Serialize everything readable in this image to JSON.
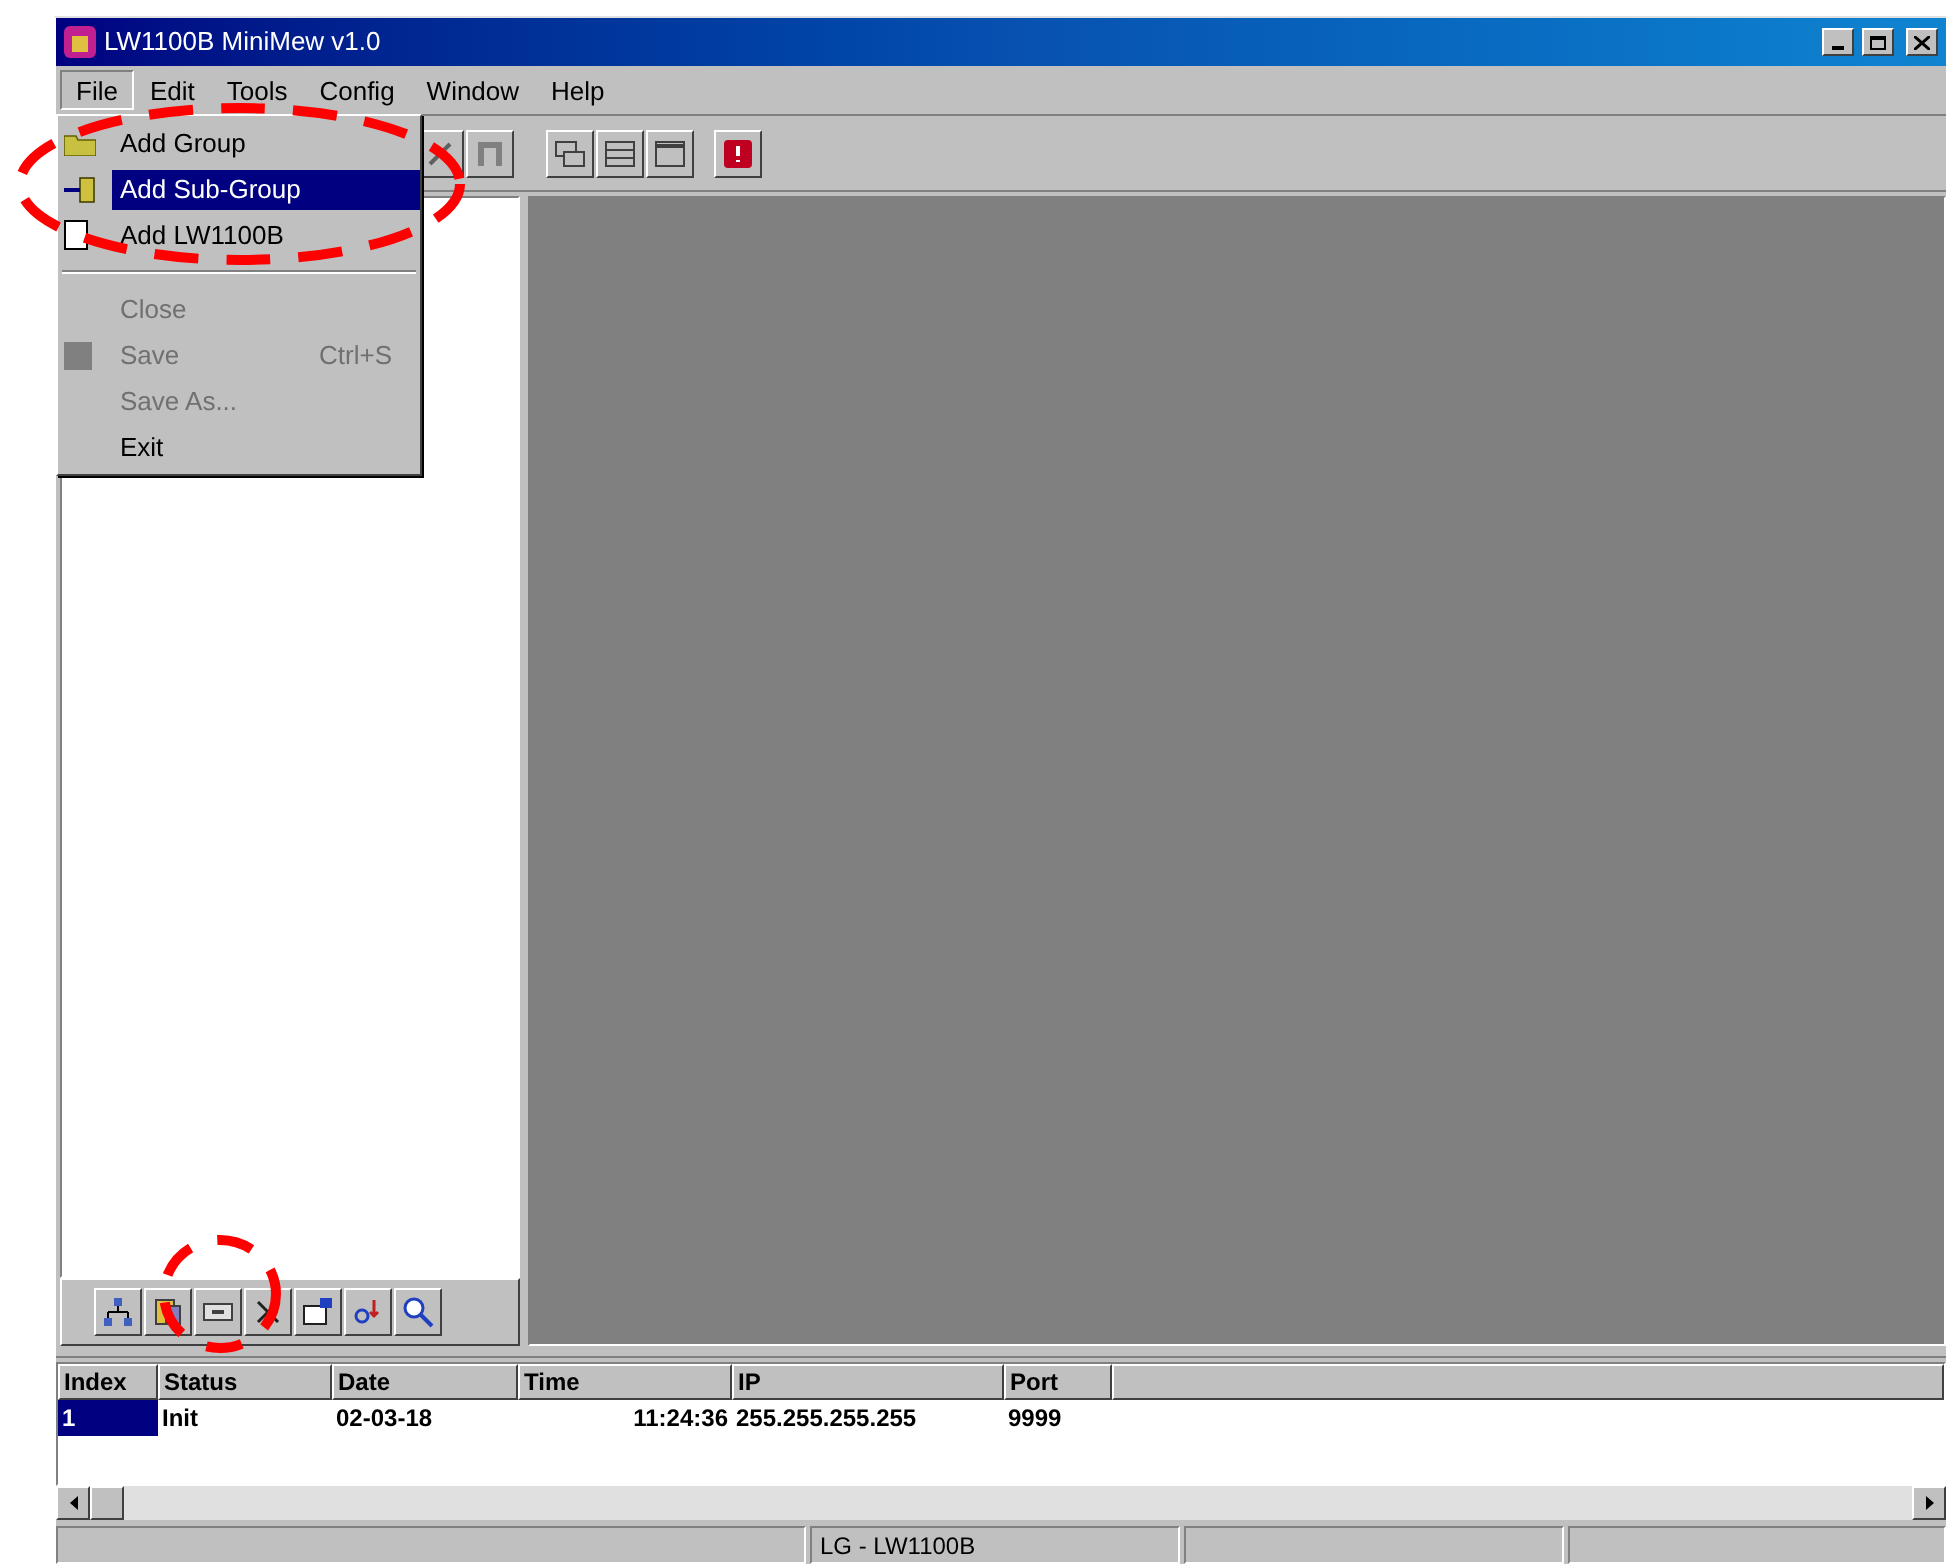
{
  "window": {
    "title": "LW1100B MiniMew v1.0"
  },
  "menu_bar": [
    {
      "label": "File",
      "selected": true
    },
    {
      "label": "Edit",
      "selected": false
    },
    {
      "label": "Tools",
      "selected": false
    },
    {
      "label": "Config",
      "selected": false
    },
    {
      "label": "Window",
      "selected": false
    },
    {
      "label": "Help",
      "selected": false
    }
  ],
  "file_menu": [
    {
      "kind": "item",
      "label": "Add Group",
      "disabled": false,
      "selected": false
    },
    {
      "kind": "item",
      "label": "Add Sub-Group",
      "disabled": false,
      "selected": true
    },
    {
      "kind": "item",
      "label": "Add LW1100B",
      "disabled": false,
      "selected": false
    },
    {
      "kind": "separator"
    },
    {
      "kind": "item",
      "label": "Close",
      "disabled": true,
      "selected": false
    },
    {
      "kind": "item",
      "label": "Save",
      "shortcut": "Ctrl+S",
      "disabled": true,
      "selected": false
    },
    {
      "kind": "item",
      "label": "Save As...",
      "disabled": true,
      "selected": false
    },
    {
      "kind": "item",
      "label": "Exit",
      "disabled": false,
      "selected": false
    }
  ],
  "table": {
    "columns": [
      "Index",
      "Status",
      "Date",
      "Time",
      "IP",
      "Port"
    ],
    "rows": [
      {
        "selected": true,
        "cells": [
          "1",
          "Init",
          "02-03-18",
          "11:24:36",
          "255.255.255.255",
          "9999"
        ]
      }
    ]
  },
  "status_bar": {
    "text": "LG - LW1100B"
  }
}
